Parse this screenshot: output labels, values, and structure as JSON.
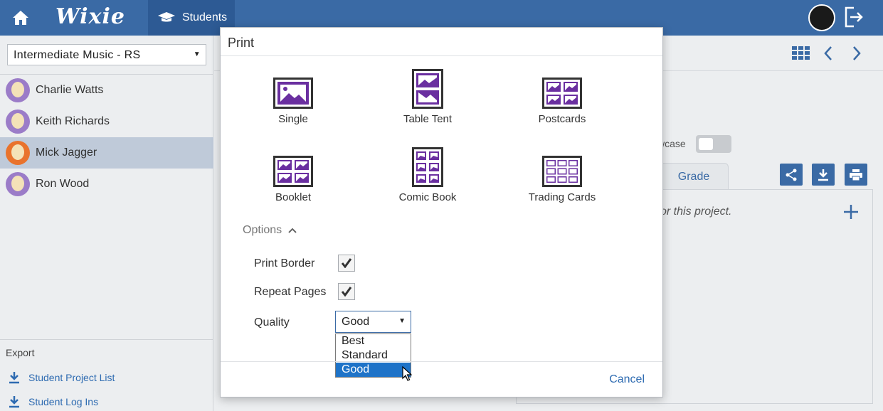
{
  "header": {
    "logo": "Wixie",
    "students_tab": "Students"
  },
  "sidebar": {
    "class_selector": "Intermediate Music - RS",
    "students": [
      {
        "name": "Charlie Watts",
        "selected": false
      },
      {
        "name": "Keith Richards",
        "selected": false
      },
      {
        "name": "Mick Jagger",
        "selected": true
      },
      {
        "name": "Ron Wood",
        "selected": false
      }
    ],
    "export": {
      "label": "Export",
      "links": [
        "Student Project List",
        "Student Log Ins"
      ]
    }
  },
  "main": {
    "showcase_label": "wcase",
    "grade_tab": "Grade",
    "empty_message": "or this project."
  },
  "modal": {
    "title": "Print",
    "layouts": [
      {
        "label": "Single",
        "icon": "single-layout-icon"
      },
      {
        "label": "Table Tent",
        "icon": "table-tent-layout-icon"
      },
      {
        "label": "Postcards",
        "icon": "postcards-layout-icon"
      },
      {
        "label": "Booklet",
        "icon": "booklet-layout-icon"
      },
      {
        "label": "Comic Book",
        "icon": "comic-book-layout-icon"
      },
      {
        "label": "Trading Cards",
        "icon": "trading-cards-layout-icon"
      }
    ],
    "options_label": "Options",
    "print_border_label": "Print Border",
    "print_border_checked": true,
    "repeat_pages_label": "Repeat Pages",
    "repeat_pages_checked": true,
    "quality_label": "Quality",
    "quality_value": "Good",
    "quality_options": [
      "Best",
      "Standard",
      "Good"
    ],
    "cancel_label": "Cancel"
  },
  "colors": {
    "topbar": "#3a6aa5",
    "accent_purple": "#6a2fa0",
    "link_blue": "#2e6bb1",
    "selected_row": "#bfcad9",
    "dropdown_highlight": "#1e73c8"
  }
}
